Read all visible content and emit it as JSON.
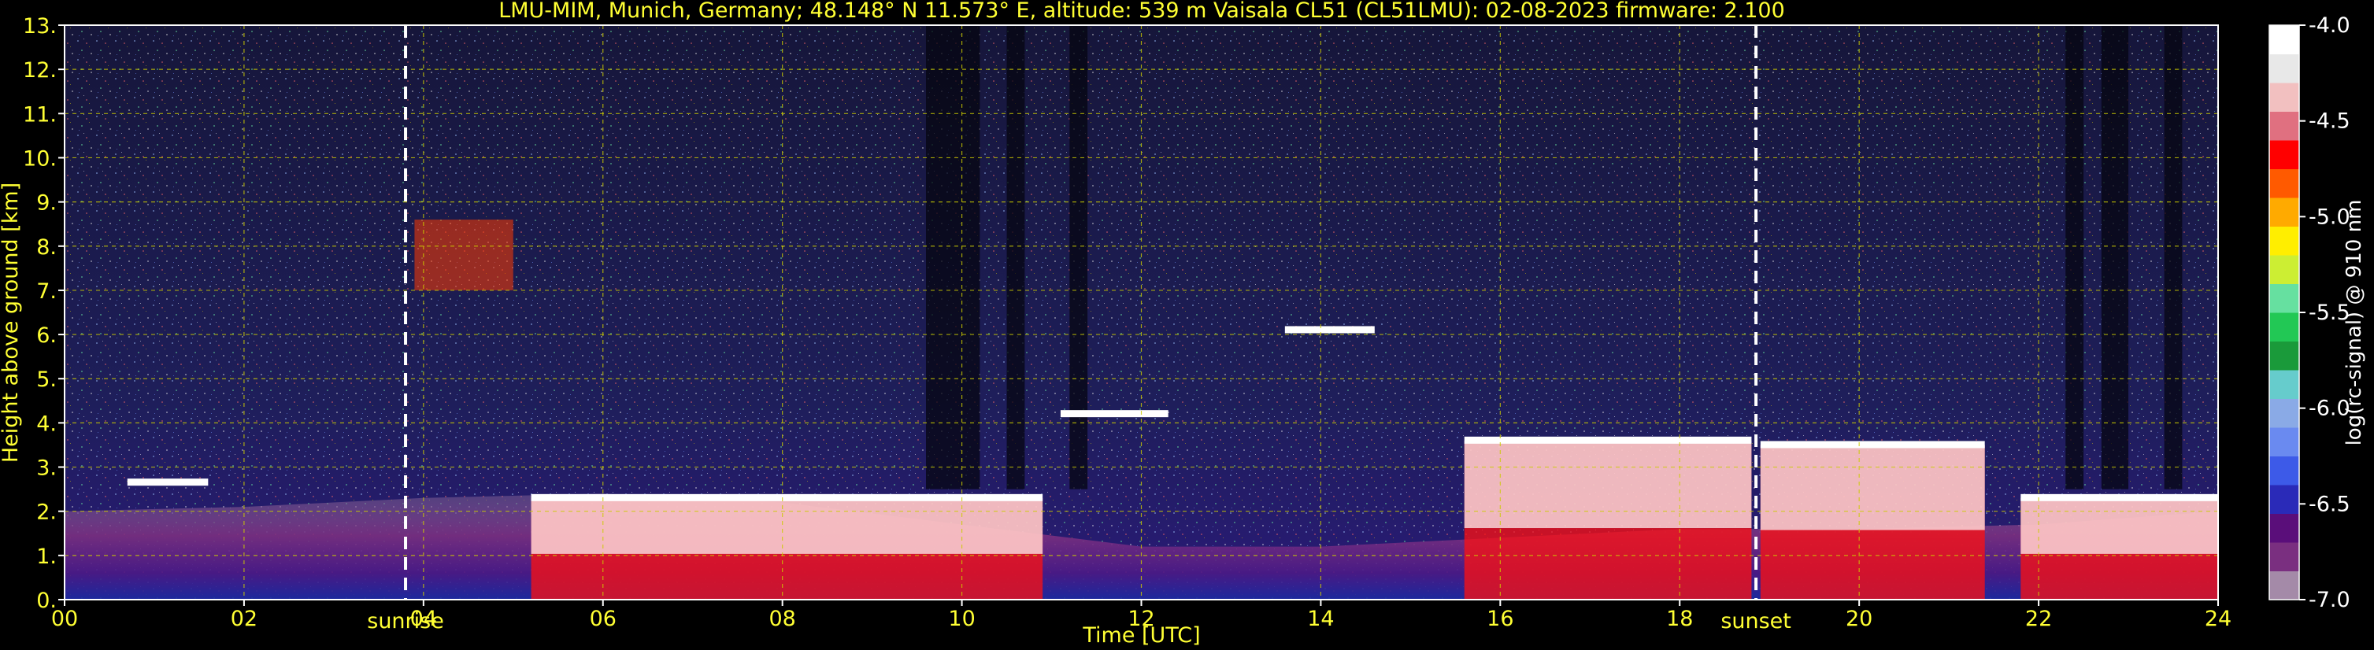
{
  "chart_data": {
    "type": "heatmap",
    "title": "LMU-MIM, Munich, Germany; 48.148° N 11.573° E, altitude: 539 m    Vaisala CL51 (CL51LMU): 02-08-2023    firmware: 2.100",
    "xlabel": "Time [UTC]",
    "ylabel": "Height above ground [km]",
    "xlim": [
      0,
      24
    ],
    "ylim": [
      0,
      13
    ],
    "x_ticks": [
      0,
      2,
      4,
      6,
      8,
      10,
      12,
      14,
      16,
      18,
      20,
      22,
      24
    ],
    "x_tick_labels": [
      "00",
      "02",
      "04",
      "06",
      "08",
      "10",
      "12",
      "14",
      "16",
      "18",
      "20",
      "22",
      "24"
    ],
    "y_ticks": [
      0,
      1,
      2,
      3,
      4,
      5,
      6,
      7,
      8,
      9,
      10,
      11,
      12,
      13
    ],
    "y_tick_labels": [
      "0.",
      "1.",
      "2.",
      "3.",
      "4.",
      "5.",
      "6.",
      "7.",
      "8.",
      "9.",
      "10.",
      "11.",
      "12.",
      "13."
    ],
    "grid": true,
    "colorbar": {
      "label": "log(rc-signal) @ 910 nm",
      "range": [
        -7.0,
        -4.0
      ],
      "ticks": [
        -4.0,
        -4.5,
        -5.0,
        -5.5,
        -6.0,
        -6.5,
        -7.0
      ],
      "tick_labels": [
        "-4.0",
        "-4.5",
        "-5.0",
        "-5.5",
        "-6.0",
        "-6.5",
        "-7.0"
      ],
      "colors": [
        "#a48aa8",
        "#7a2f80",
        "#5a0e7a",
        "#2a2ab8",
        "#3d5ae8",
        "#6a8af0",
        "#8aaae6",
        "#66cccc",
        "#1a9a3a",
        "#22c855",
        "#66e0a0",
        "#ccee33",
        "#ffee00",
        "#ffaa00",
        "#ff5a00",
        "#ff0000",
        "#e07080",
        "#f2c0c0",
        "#e8e8e8",
        "#ffffff"
      ]
    },
    "markers": [
      {
        "label": "sunrise",
        "x": 3.8
      },
      {
        "label": "sunset",
        "x": 18.85
      }
    ],
    "boundary_layer_top_km": [
      {
        "x": 0,
        "y": 2.0
      },
      {
        "x": 2,
        "y": 2.1
      },
      {
        "x": 4,
        "y": 2.3
      },
      {
        "x": 6,
        "y": 2.4
      },
      {
        "x": 8,
        "y": 2.2
      },
      {
        "x": 10,
        "y": 1.7
      },
      {
        "x": 12,
        "y": 1.2
      },
      {
        "x": 14,
        "y": 1.2
      },
      {
        "x": 16,
        "y": 1.4
      },
      {
        "x": 18,
        "y": 1.6
      },
      {
        "x": 20,
        "y": 1.6
      },
      {
        "x": 22,
        "y": 1.7
      },
      {
        "x": 24,
        "y": 2.0
      }
    ],
    "cloud_layers": [
      {
        "x_start": 0.7,
        "x_end": 1.6,
        "height_km": 2.65
      },
      {
        "x_start": 5.2,
        "x_end": 10.9,
        "height_km": 2.3
      },
      {
        "x_start": 11.1,
        "x_end": 12.3,
        "height_km": 4.2
      },
      {
        "x_start": 13.6,
        "x_end": 14.6,
        "height_km": 6.1
      },
      {
        "x_start": 15.6,
        "x_end": 18.8,
        "height_km": 3.6
      },
      {
        "x_start": 18.9,
        "x_end": 21.4,
        "height_km": 3.5
      },
      {
        "x_start": 21.8,
        "x_end": 24.0,
        "height_km": 2.3
      },
      {
        "x_start": 3.9,
        "x_end": 5.0,
        "height_km": 8.0
      }
    ]
  }
}
